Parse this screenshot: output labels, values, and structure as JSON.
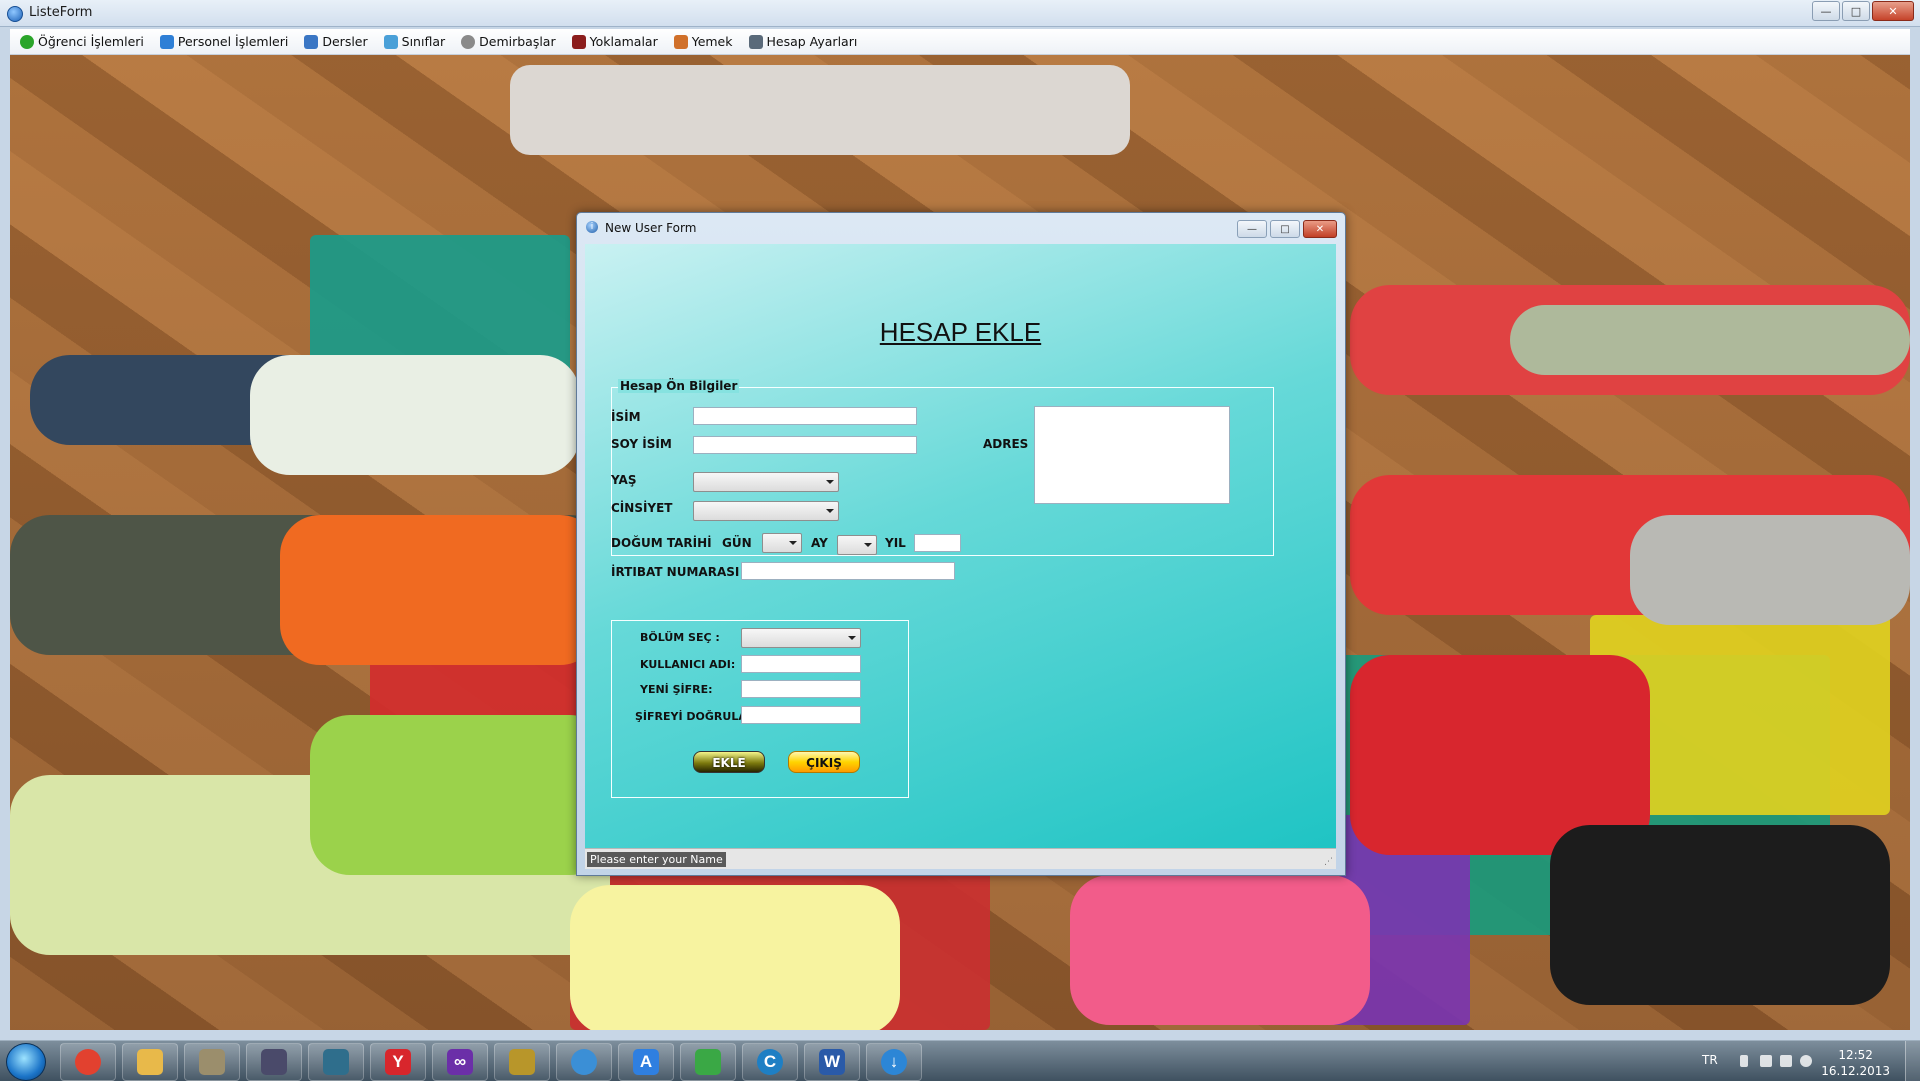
{
  "main_window": {
    "title": "ListeForm",
    "controls": {
      "minimize": "—",
      "maximize": "□",
      "close": "✕"
    }
  },
  "menu": {
    "items": [
      {
        "label": "Öğrenci İşlemleri",
        "icon": "green-check-icon",
        "color": "#2aa52a"
      },
      {
        "label": "Personel İşlemleri",
        "icon": "refresh-arrows-icon",
        "color": "#2e7fd6"
      },
      {
        "label": "Dersler",
        "icon": "snowflake-icon",
        "color": "#3a76c4"
      },
      {
        "label": "Sınıflar",
        "icon": "recycle-icon",
        "color": "#4aa0d8"
      },
      {
        "label": "Demirbaşlar",
        "icon": "gear-icon",
        "color": "#8a8a8a"
      },
      {
        "label": "Yoklamalar",
        "icon": "shield-icon",
        "color": "#8b1d1d"
      },
      {
        "label": "Yemek",
        "icon": "food-icon",
        "color": "#d0702a"
      },
      {
        "label": "Hesap Ayarları",
        "icon": "document-pen-icon",
        "color": "#5a6a7a"
      }
    ]
  },
  "dialog": {
    "title": "New User Form",
    "controls": {
      "minimize": "—",
      "maximize": "□",
      "close": "✕"
    },
    "heading": "HESAP EKLE",
    "group1": {
      "legend": "Hesap Ön Bilgiler",
      "isim_label": "İSİM",
      "soyisim_label": "SOY İSİM",
      "yas_label": "YAŞ",
      "cinsiyet_label": "CİNSİYET",
      "dogum_label": "DOĞUM TARİHİ",
      "gun_label": "GÜN",
      "ay_label": "AY",
      "yil_label": "YIL",
      "irtibat_label": "İRTIBAT NUMARASI",
      "adres_label": "ADRES",
      "isim_value": "",
      "soyisim_value": "",
      "yil_value": "",
      "irtibat_value": ""
    },
    "group2": {
      "bolum_label": "BÖLÜM SEÇ :",
      "kullanici_label": "KULLANICI ADI:",
      "yeni_sifre_label": "YENİ ŞİFRE:",
      "sifre_dogrula_label": "ŞİFREYİ DOĞRULA:",
      "ekle_button": "EKLE",
      "cikis_button": "ÇIKIŞ"
    },
    "status": "Please enter your Name"
  },
  "taskbar": {
    "apps": [
      {
        "name": "chrome-icon",
        "glyph": "",
        "color": "#e2412f"
      },
      {
        "name": "folder-icon",
        "glyph": "",
        "color": "#e8b94a"
      },
      {
        "name": "books-icon",
        "glyph": "",
        "color": "#9b8e6c"
      },
      {
        "name": "film-icon",
        "glyph": "",
        "color": "#4a4a6a"
      },
      {
        "name": "game-icon",
        "glyph": "",
        "color": "#2f6e8c"
      },
      {
        "name": "yandex-icon",
        "glyph": "Y",
        "color": "#d8262c"
      },
      {
        "name": "visual-studio-icon",
        "glyph": "∞",
        "color": "#6b2fa8"
      },
      {
        "name": "tools-icon",
        "glyph": "",
        "color": "#b8962a"
      },
      {
        "name": "blue-circle-icon",
        "glyph": "",
        "color": "#3b8fd6"
      },
      {
        "name": "app-store-icon",
        "glyph": "A",
        "color": "#2f7fe0"
      },
      {
        "name": "arrows-icon",
        "glyph": "",
        "color": "#3aa845"
      },
      {
        "name": "ccleaner-icon",
        "glyph": "C",
        "color": "#1e7fc4"
      },
      {
        "name": "word-icon",
        "glyph": "W",
        "color": "#2a5aa8"
      },
      {
        "name": "download-icon",
        "glyph": "↓",
        "color": "#2c86d6"
      }
    ],
    "tray": {
      "language": "TR",
      "time": "12:52",
      "date": "16.12.2013"
    }
  }
}
